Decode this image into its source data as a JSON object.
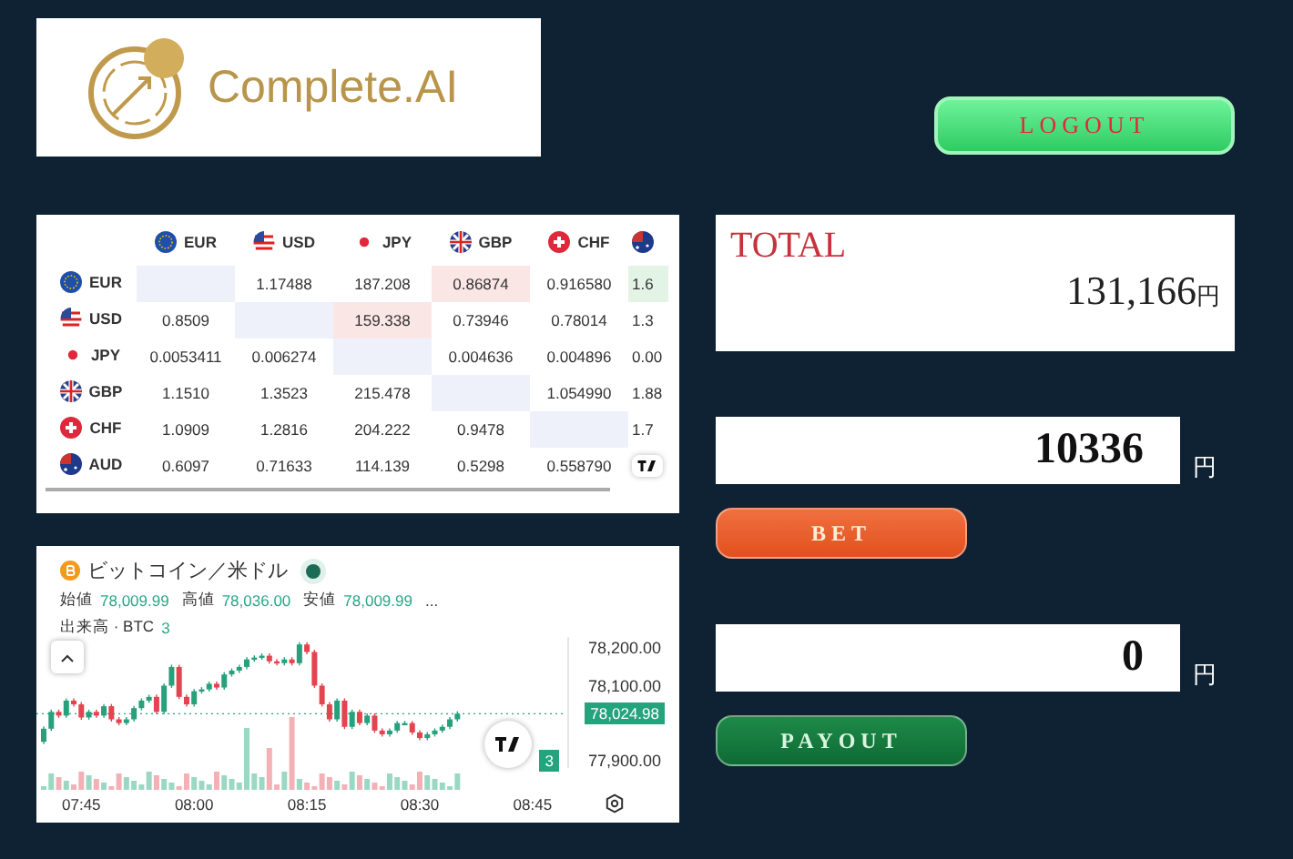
{
  "logo": {
    "text": "Complete.AI"
  },
  "logout_button": {
    "label": "LOGOUT"
  },
  "rates_table": {
    "columns": [
      {
        "code": "EUR",
        "kind": "eu"
      },
      {
        "code": "USD",
        "kind": "us"
      },
      {
        "code": "JPY",
        "kind": "jp"
      },
      {
        "code": "GBP",
        "kind": "gb"
      },
      {
        "code": "CHF",
        "kind": "ch"
      },
      {
        "kind": "au"
      }
    ],
    "rows": [
      {
        "code": "EUR",
        "kind": "eu",
        "cells": [
          {
            "color": "#eef1fa"
          },
          {
            "text": "1.17488"
          },
          {
            "text": "187.208"
          },
          {
            "text": "0.86874",
            "color": "#fbe6e6"
          },
          {
            "text": "0.916580"
          },
          {
            "text": "1.6",
            "color": "#e3f3e6"
          }
        ]
      },
      {
        "code": "USD",
        "kind": "us",
        "cells": [
          {
            "text": "0.8509"
          },
          {
            "color": "#eef1fa"
          },
          {
            "text": "159.338",
            "color": "#fbe6e6"
          },
          {
            "text": "0.73946"
          },
          {
            "text": "0.78014"
          },
          {
            "text": "1.3"
          }
        ]
      },
      {
        "code": "JPY",
        "kind": "jp",
        "cells": [
          {
            "text": "0.0053411"
          },
          {
            "text": "0.006274"
          },
          {
            "color": "#eef1fa"
          },
          {
            "text": "0.004636"
          },
          {
            "text": "0.004896"
          },
          {
            "text": "0.00"
          }
        ]
      },
      {
        "code": "GBP",
        "kind": "gb",
        "cells": [
          {
            "text": "1.1510"
          },
          {
            "text": "1.3523"
          },
          {
            "text": "215.478"
          },
          {
            "color": "#eef1fa"
          },
          {
            "text": "1.054990"
          },
          {
            "text": "1.88"
          }
        ]
      },
      {
        "code": "CHF",
        "kind": "ch",
        "cells": [
          {
            "text": "1.0909"
          },
          {
            "text": "1.2816"
          },
          {
            "text": "204.222"
          },
          {
            "text": "0.9478"
          },
          {
            "color": "#eef1fa"
          },
          {
            "text": "1.7"
          }
        ]
      },
      {
        "code": "AUD",
        "kind": "au",
        "cells": [
          {
            "text": "0.6097"
          },
          {
            "text": "0.71633"
          },
          {
            "text": "114.139"
          },
          {
            "text": "0.5298"
          },
          {
            "text": "0.558790"
          },
          {
            "kind": "logo"
          }
        ]
      }
    ]
  },
  "price_chart": {
    "symbol": "ビットコイン／米ドル",
    "ohlc_labels": [
      {
        "label": "始値",
        "value": "78,009.99"
      },
      {
        "label": "高値",
        "value": "78,036.00"
      },
      {
        "label": "安値",
        "value": "78,009.99"
      }
    ],
    "more": "...",
    "volume_label": "出来高 · BTC",
    "volume_value": "3",
    "last_price": "78,024.98",
    "volume_tag": "3",
    "chart_data": {
      "type": "candlestick",
      "categories": [
        null,
        null,
        null,
        null,
        null,
        "07:45",
        null,
        null,
        null,
        null,
        null,
        null,
        null,
        null,
        null,
        null,
        null,
        null,
        null,
        null,
        "08:00",
        null,
        null,
        null,
        null,
        null,
        null,
        null,
        null,
        null,
        null,
        null,
        null,
        null,
        null,
        "08:15",
        null,
        null,
        null,
        null,
        null,
        null,
        null,
        null,
        null,
        null,
        null,
        null,
        null,
        null,
        "08:30",
        null,
        null,
        null,
        null,
        null,
        null,
        null,
        null,
        null,
        null,
        null,
        null,
        null,
        null,
        "08:45"
      ],
      "ohlc": [
        [
          77950,
          77991,
          77944,
          77985
        ],
        [
          77985,
          78036,
          77979,
          78030
        ],
        [
          78030,
          78036,
          78014,
          78020
        ],
        [
          78020,
          78066,
          78014,
          78060
        ],
        [
          78060,
          78066,
          78044,
          78050
        ],
        [
          78050,
          78056,
          78009,
          78015
        ],
        [
          78015,
          78036,
          78009,
          78030
        ],
        [
          78030,
          78036,
          78014,
          78020
        ],
        [
          78020,
          78051,
          78014,
          78045
        ],
        [
          78045,
          78051,
          78004,
          78010
        ],
        [
          78010,
          78016,
          77994,
          78000
        ],
        [
          78000,
          78016,
          77994,
          78010
        ],
        [
          78010,
          78046,
          78004,
          78040
        ],
        [
          78040,
          78066,
          78034,
          78060
        ],
        [
          78060,
          78076,
          78054,
          78070
        ],
        [
          78070,
          78076,
          78024,
          78030
        ],
        [
          78030,
          78106,
          78024,
          78100
        ],
        [
          78100,
          78156,
          78094,
          78150
        ],
        [
          78150,
          78156,
          78064,
          78070
        ],
        [
          78070,
          78076,
          78044,
          78050
        ],
        [
          78050,
          78091,
          78044,
          78085
        ],
        [
          78085,
          78096,
          78079,
          78090
        ],
        [
          78090,
          78111,
          78084,
          78105
        ],
        [
          78105,
          78111,
          78089,
          78095
        ],
        [
          78095,
          78136,
          78089,
          78130
        ],
        [
          78130,
          78146,
          78124,
          78140
        ],
        [
          78140,
          78156,
          78134,
          78150
        ],
        [
          78150,
          78176,
          78144,
          78170
        ],
        [
          78170,
          78181,
          78164,
          78175
        ],
        [
          78175,
          78186,
          78169,
          78180
        ],
        [
          78180,
          78186,
          78159,
          78165
        ],
        [
          78165,
          78171,
          78154,
          78160
        ],
        [
          78160,
          78176,
          78154,
          78170
        ],
        [
          78170,
          78176,
          78154,
          78160
        ],
        [
          78160,
          78216,
          78154,
          78210
        ],
        [
          78210,
          78216,
          78184,
          78190
        ],
        [
          78190,
          78196,
          78094,
          78100
        ],
        [
          78100,
          78106,
          78044,
          78050
        ],
        [
          78050,
          78056,
          78004,
          78010
        ],
        [
          78010,
          78066,
          78004,
          78060
        ],
        [
          78060,
          78066,
          77984,
          77990
        ],
        [
          77990,
          78036,
          77984,
          78030
        ],
        [
          78030,
          78036,
          77994,
          78000
        ],
        [
          78000,
          78026,
          77994,
          78020
        ],
        [
          78020,
          78026,
          77974,
          77980
        ],
        [
          77980,
          77986,
          77964,
          77970
        ],
        [
          77970,
          77986,
          77964,
          77980
        ],
        [
          77980,
          78006,
          77974,
          78000
        ],
        [
          78000,
          78006,
          77994,
          78000
        ],
        [
          78000,
          78006,
          77969,
          77975
        ],
        [
          77975,
          77981,
          77954,
          77960
        ],
        [
          77960,
          77976,
          77954,
          77970
        ],
        [
          77970,
          77986,
          77964,
          77980
        ],
        [
          77980,
          77996,
          77974,
          77990
        ],
        [
          77990,
          78016,
          77984,
          78010
        ],
        [
          78010,
          78031,
          78004,
          78025
        ],
        null,
        null,
        null,
        null,
        null,
        null,
        null,
        null,
        null,
        null
      ],
      "ylim": [
        77880,
        78230
      ],
      "ref_lines": [
        {
          "axis": "y",
          "value": 78024.98
        }
      ],
      "yticks": [
        {
          "value": 78200,
          "label": "78,200.00"
        },
        {
          "value": 78100,
          "label": "78,100.00"
        },
        {
          "value": 77900,
          "label": "77,900.00"
        }
      ]
    }
  },
  "total": {
    "label": "TOTAL",
    "amount": "131,166",
    "unit": "円"
  },
  "bet": {
    "value": "10336",
    "unit": "円",
    "button": "BET"
  },
  "payout": {
    "value": "0",
    "unit": "円",
    "button": "PAYOUT"
  }
}
